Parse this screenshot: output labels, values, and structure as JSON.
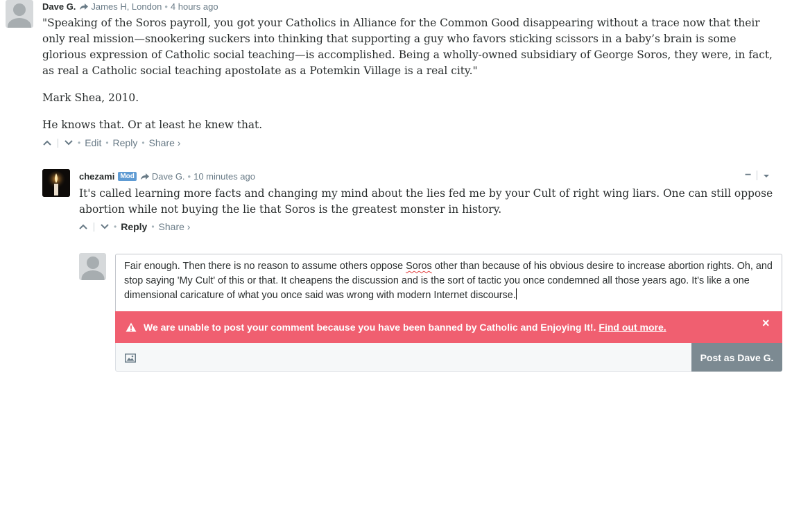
{
  "comment1": {
    "author": "Dave G.",
    "reply_to": "James H, London",
    "time": "4 hours ago",
    "paragraphs": [
      "\"Speaking of the Soros payroll, you got your Catholics in Alliance for the Common Good disappearing without a trace now that their only real mission—snookering suckers into thinking that supporting a guy who favors sticking scissors in a baby’s brain is some glorious expression of Catholic social teaching—is accomplished. Being a wholly-owned subsidiary of George Soros, they were, in fact, as real a Catholic social teaching apostolate as a Potemkin Village is a real city.\"",
      "Mark Shea, 2010.",
      "He knows that. Or at least he knew that."
    ],
    "actions": {
      "edit": "Edit",
      "reply": "Reply",
      "share": "Share ›"
    }
  },
  "comment2": {
    "author": "chezami",
    "badge": "Mod",
    "reply_to": "Dave G.",
    "time": "10 minutes ago",
    "text": "It's called learning more facts and changing my mind about the lies fed me by your Cult of right wing liars. One can still oppose abortion while not buying the lie that Soros is the greatest monster in history.",
    "actions": {
      "reply": "Reply",
      "share": "Share ›"
    },
    "collapse": "−"
  },
  "reply_box": {
    "text_before": "Fair enough.  Then there is no reason to assume others oppose ",
    "misspelled": "Soros",
    "text_after": " other than because of his obvious desire to increase abortion rights.  Oh, and stop saying 'My Cult' of this or that.  It cheapens the discussion and is the sort of tactic you once condemned all those years ago. It's like a one dimensional caricature of what you once said was wrong with modern Internet discourse.",
    "banner": {
      "message": "We are unable to post your comment because you have been banned by Catholic and Enjoying It!.",
      "link": "Find out more.",
      "close": "×",
      "color": "#f05f70"
    },
    "post_button": "Post as Dave G."
  }
}
